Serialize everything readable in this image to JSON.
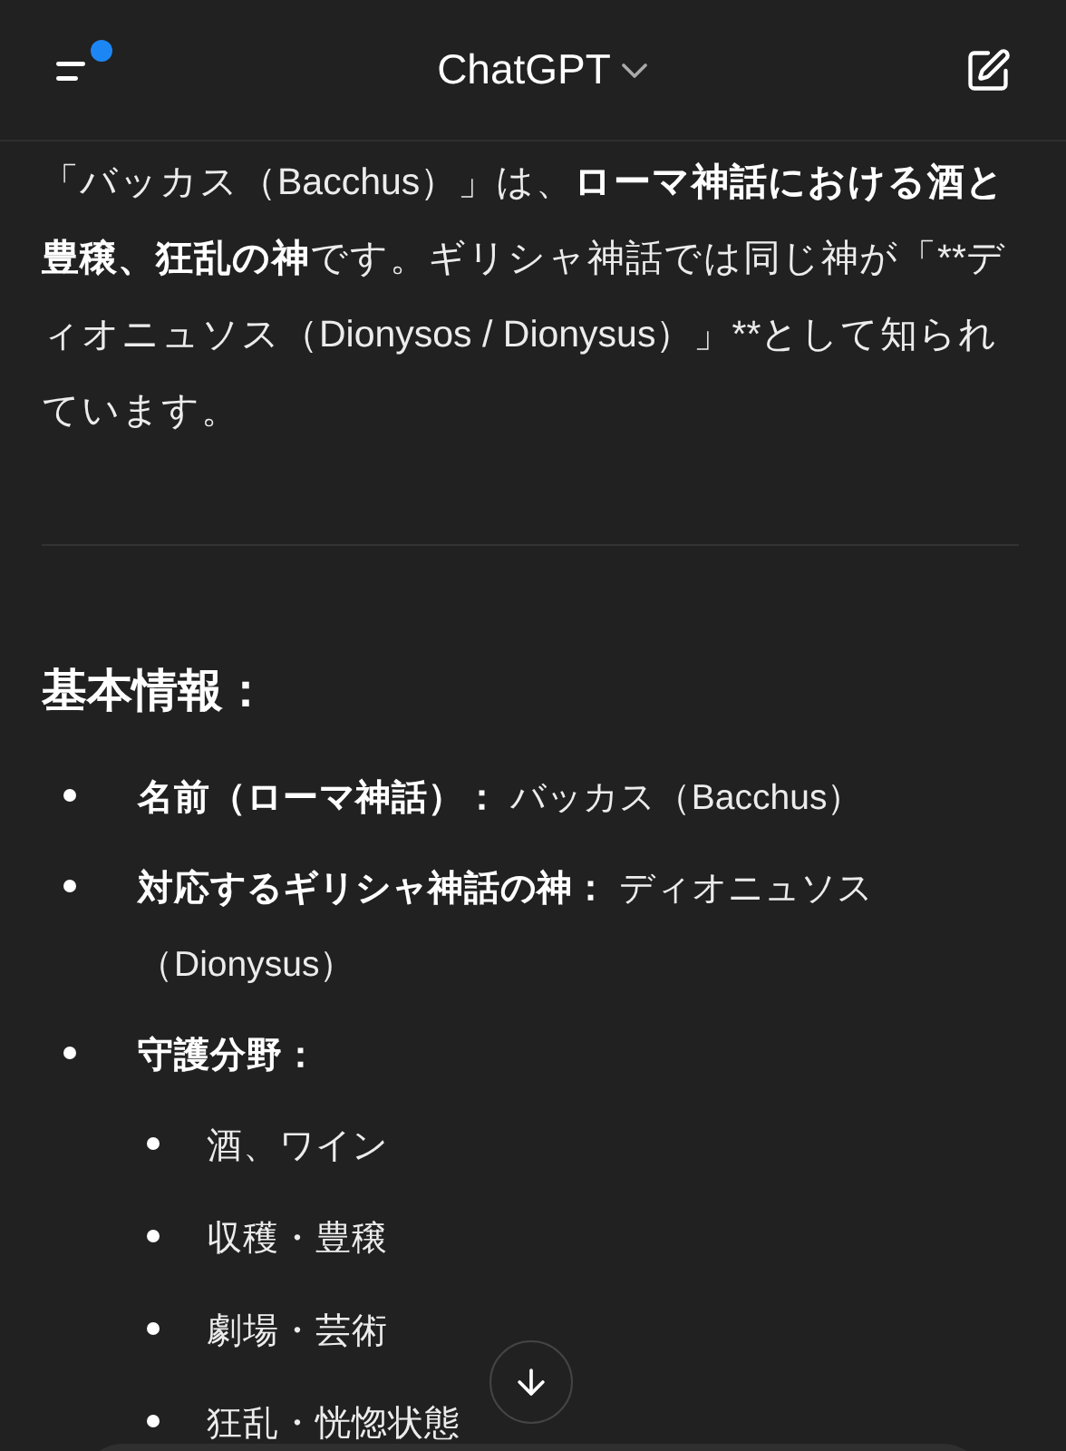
{
  "header": {
    "title": "ChatGPT",
    "has_notification": true
  },
  "intro": [
    {
      "text": "「バッカス（Bacchus）」は、",
      "bold": false
    },
    {
      "text": "ローマ神話における酒と豊穣、狂乱の神",
      "bold": true
    },
    {
      "text": "です。ギリシャ神話では同じ神が「**ディオニュソス（Dionysos / Dionysus）」**として知られています。",
      "bold": false
    }
  ],
  "section": {
    "heading": "基本情報：",
    "items": [
      {
        "label": "名前（ローマ神話）：",
        "value": "バッカス（Bacchus）"
      },
      {
        "label": "対応するギリシャ神話の神：",
        "value": "ディオニュソス（Dionysus）"
      },
      {
        "label": "守護分野：",
        "children": [
          {
            "value": "酒、ワイン"
          },
          {
            "value": "収穫・豊穣"
          },
          {
            "value": "劇場・芸術"
          },
          {
            "value": "狂乱・恍惚状態"
          }
        ]
      }
    ]
  }
}
